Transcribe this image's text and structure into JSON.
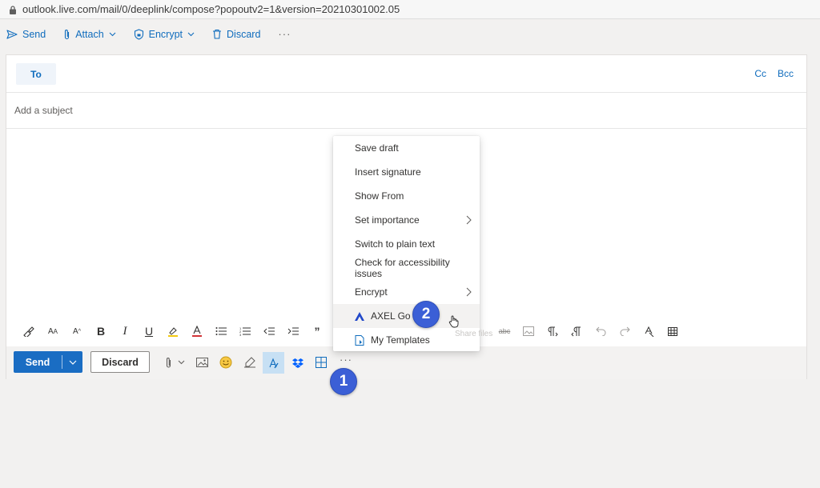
{
  "browser": {
    "url": "outlook.live.com/mail/0/deeplink/compose?popoutv2=1&version=20210301002.05"
  },
  "toolbar": {
    "send_label": "Send",
    "attach_label": "Attach",
    "encrypt_label": "Encrypt",
    "discard_label": "Discard",
    "more_label": "···"
  },
  "compose": {
    "to_label": "To",
    "cc_label": "Cc",
    "bcc_label": "Bcc",
    "subject_placeholder": "Add a subject"
  },
  "actions": {
    "send_label": "Send",
    "discard_label": "Discard",
    "more_label": "···"
  },
  "menu": {
    "items": [
      {
        "label": "Save draft"
      },
      {
        "label": "Insert signature"
      },
      {
        "label": "Show From"
      },
      {
        "label": "Set importance",
        "submenu": true
      },
      {
        "label": "Switch to plain text"
      },
      {
        "label": "Check for accessibility issues"
      },
      {
        "label": "Encrypt",
        "submenu": true
      },
      {
        "label": "AXEL Go",
        "icon": "axel-go-icon"
      },
      {
        "label": "My Templates",
        "icon": "templates-icon"
      }
    ]
  },
  "ghost_tooltip": "Share files",
  "badges": {
    "step1": "1",
    "step2": "2"
  },
  "colors": {
    "accent": "#0f6cbd",
    "send_button": "#1a6dc3",
    "badge": "#3b5fd6"
  }
}
